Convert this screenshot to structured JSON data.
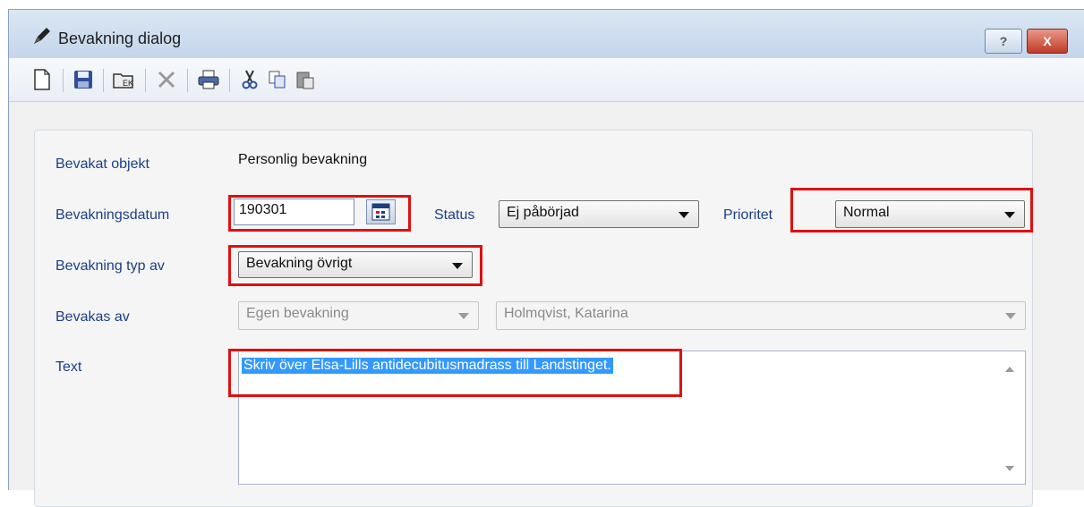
{
  "window": {
    "title": "Bevakning dialog",
    "help_label": "?",
    "close_label": "X"
  },
  "toolbar": {
    "icons": [
      "new-document-icon",
      "save-icon",
      "open-folder-icon",
      "delete-icon",
      "print-icon",
      "cut-icon",
      "copy-icon",
      "paste-icon"
    ]
  },
  "form": {
    "object_label": "Bevakat objekt",
    "object_value": "Personlig bevakning",
    "date_label": "Bevakningsdatum",
    "date_value": "190301",
    "status_label": "Status",
    "status_value": "Ej påbörjad",
    "priority_label": "Prioritet",
    "priority_value": "Normal",
    "type_label": "Bevakning typ av",
    "type_value": "Bevakning övrigt",
    "watched_by_label": "Bevakas av",
    "watched_by_value": "Egen bevakning",
    "person_value": "Holmqvist, Katarina",
    "text_label": "Text",
    "text_value": "Skriv över Elsa-Lills antidecubitusmadrass till Landstinget."
  },
  "colors": {
    "highlight": "#e01010",
    "label": "#1c3f8a",
    "selection": "#3399ff"
  }
}
